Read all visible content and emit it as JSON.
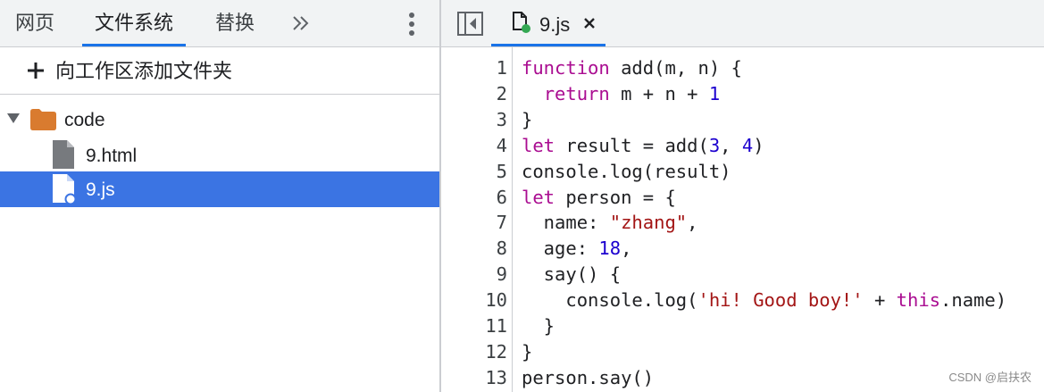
{
  "left_panel": {
    "tabs": [
      {
        "label": "网页"
      },
      {
        "label": "文件系统"
      },
      {
        "label": "替换"
      }
    ],
    "more_tabs_icon": "double-chevron-right-icon",
    "menu_icon": "kebab-menu-icon",
    "add_folder_label": "向工作区添加文件夹",
    "tree": {
      "folder": {
        "label": "code",
        "color": "#d97b2f"
      },
      "files": [
        {
          "label": "9.html",
          "selected": false
        },
        {
          "label": "9.js",
          "selected": true
        }
      ]
    }
  },
  "editor": {
    "tab": {
      "label": "9.js",
      "modified_dot_color": "#34a853"
    },
    "lines": [
      {
        "n": "1",
        "code": [
          {
            "t": "function",
            "k": "kw"
          },
          {
            "t": " add(m, n) {"
          }
        ]
      },
      {
        "n": "2",
        "code": [
          {
            "t": "  "
          },
          {
            "t": "return",
            "k": "kw"
          },
          {
            "t": " m + n + "
          },
          {
            "t": "1",
            "k": "num"
          }
        ]
      },
      {
        "n": "3",
        "code": [
          {
            "t": "}"
          }
        ]
      },
      {
        "n": "4",
        "code": [
          {
            "t": "let",
            "k": "kw"
          },
          {
            "t": " result = add("
          },
          {
            "t": "3",
            "k": "num"
          },
          {
            "t": ", "
          },
          {
            "t": "4",
            "k": "num"
          },
          {
            "t": ")"
          }
        ]
      },
      {
        "n": "5",
        "code": [
          {
            "t": "console.log(result)"
          }
        ]
      },
      {
        "n": "6",
        "code": [
          {
            "t": "let",
            "k": "kw"
          },
          {
            "t": " person = {"
          }
        ]
      },
      {
        "n": "7",
        "code": [
          {
            "t": "  name: "
          },
          {
            "t": "\"zhang\"",
            "k": "str"
          },
          {
            "t": ","
          }
        ]
      },
      {
        "n": "8",
        "code": [
          {
            "t": "  age: "
          },
          {
            "t": "18",
            "k": "num"
          },
          {
            "t": ","
          }
        ]
      },
      {
        "n": "9",
        "code": [
          {
            "t": "  say() {"
          }
        ]
      },
      {
        "n": "10",
        "code": [
          {
            "t": "    console.log("
          },
          {
            "t": "'hi! Good boy!'",
            "k": "str"
          },
          {
            "t": " + "
          },
          {
            "t": "this",
            "k": "kw"
          },
          {
            "t": ".name)"
          }
        ]
      },
      {
        "n": "11",
        "code": [
          {
            "t": "  }"
          }
        ]
      },
      {
        "n": "12",
        "code": [
          {
            "t": "}"
          }
        ]
      },
      {
        "n": "13",
        "code": [
          {
            "t": "person.say()"
          }
        ]
      }
    ]
  },
  "watermark": "CSDN @启扶农",
  "colors": {
    "accent": "#1a73e8",
    "selection": "#3b74e3",
    "keyword": "#aa0d91",
    "number": "#1c00cf",
    "string": "#a31515"
  }
}
